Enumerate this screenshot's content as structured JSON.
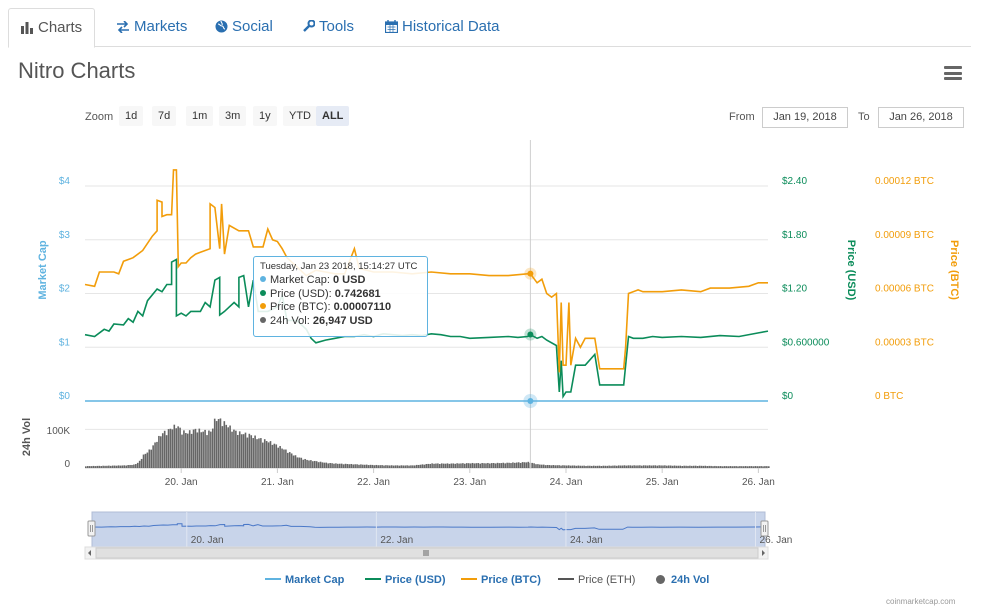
{
  "tabs": [
    {
      "label": "Charts",
      "icon": "bar-chart-icon"
    },
    {
      "label": "Markets",
      "icon": "exchange-arrows-icon"
    },
    {
      "label": "Social",
      "icon": "globe-icon"
    },
    {
      "label": "Tools",
      "icon": "wrench-icon"
    },
    {
      "label": "Historical Data",
      "icon": "calendar-icon"
    }
  ],
  "page_title": "Nitro Charts",
  "menu_icon": "hamburger-menu-icon",
  "range_selector": {
    "zoom_label": "Zoom",
    "buttons": [
      "1d",
      "7d",
      "1m",
      "3m",
      "1y",
      "YTD",
      "ALL"
    ],
    "selected": "ALL",
    "from_label": "From",
    "from_value": "Jan 19, 2018",
    "to_label": "To",
    "to_value": "Jan 26, 2018"
  },
  "tooltip": {
    "header": "Tuesday, Jan 23 2018, 15:14:27 UTC",
    "rows": [
      {
        "label": "Market Cap:",
        "value": "0 USD",
        "color": "#5fb3e0"
      },
      {
        "label": "Price (USD):",
        "value": "0.742681",
        "color": "#0b8c5a"
      },
      {
        "label": "Price (BTC):",
        "value": "0.00007110",
        "color": "#f29d0a"
      },
      {
        "label": "24h Vol:",
        "value": "26,947 USD",
        "color": "#666666"
      }
    ]
  },
  "legend": [
    {
      "label": "Market Cap",
      "color": "#5fb3e0",
      "type": "line"
    },
    {
      "label": "Price (USD)",
      "color": "#0b8c5a",
      "type": "line"
    },
    {
      "label": "Price (BTC)",
      "color": "#f29d0a",
      "type": "line"
    },
    {
      "label": "Price (ETH)",
      "color": "#555555",
      "type": "line"
    },
    {
      "label": "24h Vol",
      "color": "#666666",
      "type": "dot"
    }
  ],
  "credit": "coinmarketcap.com",
  "chart_data": {
    "type": "line",
    "x_unit": "days since Jan 19 00:00",
    "x_range": [
      0.0,
      7.1
    ],
    "x_tick_labels": [
      "20. Jan",
      "21. Jan",
      "22. Jan",
      "23. Jan",
      "24. Jan",
      "25. Jan",
      "26. Jan"
    ],
    "crosshair_x": 4.63,
    "axes": {
      "market_cap": {
        "label": "Market Cap",
        "ticks": [
          "$0",
          "$1",
          "$2",
          "$3",
          "$4"
        ],
        "range": [
          0,
          4.5
        ]
      },
      "price_usd": {
        "label": "Price (USD)",
        "ticks": [
          "$0",
          "$0.600000",
          "$1.20",
          "$1.80",
          "$2.40"
        ],
        "range": [
          0,
          2.4
        ]
      },
      "price_btc": {
        "label": "Price (BTC)",
        "ticks": [
          "0 BTC",
          "0.00003 BTC",
          "0.00006 BTC",
          "0.00009 BTC",
          "0.00012 BTC"
        ],
        "range": [
          0,
          0.00012
        ]
      },
      "volume": {
        "label": "24h Vol",
        "ticks": [
          "0",
          "100K"
        ],
        "range": [
          0,
          150000
        ]
      }
    },
    "series": [
      {
        "name": "Market Cap",
        "color": "#5fb3e0",
        "points": [
          [
            0.0,
            0
          ],
          [
            7.1,
            0
          ]
        ]
      },
      {
        "name": "Price (USD)",
        "color": "#0b8c5a",
        "points": [
          [
            0.0,
            0.74
          ],
          [
            0.1,
            0.72
          ],
          [
            0.2,
            0.8
          ],
          [
            0.25,
            0.78
          ],
          [
            0.3,
            0.86
          ],
          [
            0.4,
            0.85
          ],
          [
            0.45,
            0.92
          ],
          [
            0.5,
            0.88
          ],
          [
            0.55,
            1.0
          ],
          [
            0.6,
            0.95
          ],
          [
            0.65,
            1.12
          ],
          [
            0.75,
            1.25
          ],
          [
            0.8,
            1.22
          ],
          [
            0.85,
            1.3
          ],
          [
            0.9,
            1.3
          ],
          [
            0.9,
            1.55
          ],
          [
            0.95,
            1.58
          ],
          [
            0.95,
            0.95
          ],
          [
            1.0,
            0.98
          ],
          [
            1.05,
            0.95
          ],
          [
            1.1,
            1.0
          ],
          [
            1.2,
            1.0
          ],
          [
            1.25,
            1.1
          ],
          [
            1.3,
            1.05
          ],
          [
            1.35,
            1.35
          ],
          [
            1.4,
            1.38
          ],
          [
            1.4,
            0.96
          ],
          [
            1.45,
            1.0
          ],
          [
            1.5,
            1.05
          ],
          [
            1.55,
            1.1
          ],
          [
            1.6,
            1.05
          ],
          [
            1.6,
            1.38
          ],
          [
            1.65,
            1.4
          ],
          [
            1.7,
            1.05
          ],
          [
            1.75,
            1.35
          ],
          [
            1.8,
            1.0
          ],
          [
            1.9,
            1.0
          ],
          [
            2.0,
            1.05
          ],
          [
            2.05,
            1.18
          ],
          [
            2.1,
            0.9
          ],
          [
            2.2,
            0.9
          ],
          [
            2.3,
            0.8
          ],
          [
            2.35,
            0.7
          ],
          [
            2.4,
            0.65
          ],
          [
            2.5,
            0.68
          ],
          [
            2.6,
            0.7
          ],
          [
            2.7,
            0.72
          ],
          [
            2.8,
            0.72
          ],
          [
            2.9,
            0.74
          ],
          [
            3.0,
            0.72
          ],
          [
            3.1,
            0.75
          ],
          [
            3.2,
            0.74
          ],
          [
            3.3,
            0.73
          ],
          [
            3.4,
            0.74
          ],
          [
            3.5,
            0.73
          ],
          [
            3.6,
            0.75
          ],
          [
            3.7,
            0.74
          ],
          [
            3.8,
            0.72
          ],
          [
            3.9,
            0.72
          ],
          [
            4.0,
            0.7
          ],
          [
            4.2,
            0.71
          ],
          [
            4.4,
            0.72
          ],
          [
            4.5,
            0.71
          ],
          [
            4.6,
            0.72
          ],
          [
            4.63,
            0.74
          ],
          [
            4.7,
            0.7
          ],
          [
            4.75,
            0.72
          ],
          [
            4.8,
            0.68
          ],
          [
            4.9,
            0.62
          ],
          [
            4.93,
            0.1
          ],
          [
            4.95,
            0.45
          ],
          [
            4.97,
            0.05
          ],
          [
            5.0,
            0.1
          ],
          [
            5.05,
            0.1
          ],
          [
            5.1,
            0.4
          ],
          [
            5.2,
            0.4
          ],
          [
            5.3,
            0.52
          ],
          [
            5.35,
            0.18
          ],
          [
            5.6,
            0.18
          ],
          [
            5.65,
            0.72
          ],
          [
            5.7,
            0.7
          ],
          [
            5.8,
            0.7
          ],
          [
            5.9,
            0.72
          ],
          [
            6.0,
            0.71
          ],
          [
            6.2,
            0.72
          ],
          [
            6.4,
            0.71
          ],
          [
            6.6,
            0.73
          ],
          [
            6.8,
            0.72
          ],
          [
            7.0,
            0.76
          ],
          [
            7.1,
            0.78
          ]
        ]
      },
      {
        "name": "Price (BTC)",
        "color": "#f29d0a",
        "points": [
          [
            0.0,
            6.5e-05
          ],
          [
            0.1,
            6.4e-05
          ],
          [
            0.15,
            7.2e-05
          ],
          [
            0.3,
            7.2e-05
          ],
          [
            0.35,
            7.1e-05
          ],
          [
            0.4,
            7.8e-05
          ],
          [
            0.5,
            8e-05
          ],
          [
            0.6,
            8.4e-05
          ],
          [
            0.7,
            9.2e-05
          ],
          [
            0.75,
            9.5e-05
          ],
          [
            0.75,
            0.000112
          ],
          [
            0.8,
            0.000111
          ],
          [
            0.8,
            0.000103
          ],
          [
            0.85,
            0.000104
          ],
          [
            0.9,
            0.000104
          ],
          [
            0.92,
            0.000129
          ],
          [
            0.95,
            0.000129
          ],
          [
            0.97,
            7.5e-05
          ],
          [
            1.0,
            7.7e-05
          ],
          [
            1.05,
            7.7e-05
          ],
          [
            1.1,
            8e-05
          ],
          [
            1.15,
            8.2e-05
          ],
          [
            1.2,
            8.3e-05
          ],
          [
            1.3,
            8.5e-05
          ],
          [
            1.3,
            0.00011
          ],
          [
            1.35,
            0.000108
          ],
          [
            1.4,
            8.5e-05
          ],
          [
            1.42,
            0.00011
          ],
          [
            1.45,
            8.2e-05
          ],
          [
            1.5,
            9.8e-05
          ],
          [
            1.6,
            9.5e-05
          ],
          [
            1.7,
            9.5e-05
          ],
          [
            1.75,
            8.6e-05
          ],
          [
            1.85,
            8.6e-05
          ],
          [
            1.9,
            9.6e-05
          ],
          [
            1.95,
            9e-05
          ],
          [
            2.0,
            8.9e-05
          ],
          [
            2.05,
            8.5e-05
          ],
          [
            2.1,
            8e-05
          ],
          [
            2.2,
            7.5e-05
          ],
          [
            2.3,
            7e-05
          ],
          [
            2.4,
            7.3e-05
          ],
          [
            2.5,
            7.2e-05
          ],
          [
            2.6,
            7.1e-05
          ],
          [
            2.7,
            7.1e-05
          ],
          [
            2.8,
            8.5e-05
          ],
          [
            2.85,
            7.4e-05
          ],
          [
            3.0,
            7.2e-05
          ],
          [
            3.2,
            7.2e-05
          ],
          [
            3.4,
            7.1e-05
          ],
          [
            3.6,
            7.2e-05
          ],
          [
            3.8,
            7.1e-05
          ],
          [
            4.0,
            7.1e-05
          ],
          [
            4.2,
            7e-05
          ],
          [
            4.4,
            7e-05
          ],
          [
            4.6,
            7.1e-05
          ],
          [
            4.63,
            7.1e-05
          ],
          [
            4.7,
            6.6e-05
          ],
          [
            4.75,
            6.8e-05
          ],
          [
            4.8,
            6e-05
          ],
          [
            4.85,
            5.8e-05
          ],
          [
            4.9,
            6e-05
          ],
          [
            4.93,
            1.6e-05
          ],
          [
            4.95,
            5.5e-05
          ],
          [
            4.97,
            2e-05
          ],
          [
            5.0,
            2e-05
          ],
          [
            5.03,
            5.5e-05
          ],
          [
            5.05,
            2e-05
          ],
          [
            5.1,
            3.5e-05
          ],
          [
            5.15,
            3e-05
          ],
          [
            5.2,
            3.5e-05
          ],
          [
            5.3,
            3.5e-05
          ],
          [
            5.35,
            1.8e-05
          ],
          [
            5.6,
            1.8e-05
          ],
          [
            5.62,
            3e-05
          ],
          [
            5.65,
            6e-05
          ],
          [
            5.75,
            6.2e-05
          ],
          [
            5.8,
            6.1e-05
          ],
          [
            6.0,
            6.1e-05
          ],
          [
            6.2,
            6.2e-05
          ],
          [
            6.4,
            6.1e-05
          ],
          [
            6.5,
            6.3e-05
          ],
          [
            6.7,
            6.3e-05
          ],
          [
            6.9,
            6.4e-05
          ],
          [
            7.0,
            6.6e-05
          ],
          [
            7.1,
            6.6e-05
          ]
        ]
      }
    ],
    "volume_series": {
      "name": "24h Vol",
      "color": "#666666",
      "points": [
        [
          0.0,
          5000
        ],
        [
          0.2,
          6000
        ],
        [
          0.4,
          7000
        ],
        [
          0.5,
          9000
        ],
        [
          0.55,
          15000
        ],
        [
          0.6,
          35000
        ],
        [
          0.65,
          45000
        ],
        [
          0.7,
          60000
        ],
        [
          0.75,
          80000
        ],
        [
          0.8,
          95000
        ],
        [
          0.85,
          100000
        ],
        [
          0.9,
          110000
        ],
        [
          0.95,
          115000
        ],
        [
          1.0,
          100000
        ],
        [
          1.05,
          95000
        ],
        [
          1.1,
          100000
        ],
        [
          1.15,
          105000
        ],
        [
          1.2,
          100000
        ],
        [
          1.3,
          98000
        ],
        [
          1.35,
          135000
        ],
        [
          1.4,
          130000
        ],
        [
          1.45,
          120000
        ],
        [
          1.5,
          110000
        ],
        [
          1.55,
          100000
        ],
        [
          1.6,
          95000
        ],
        [
          1.7,
          90000
        ],
        [
          1.8,
          80000
        ],
        [
          1.9,
          72000
        ],
        [
          2.0,
          60000
        ],
        [
          2.1,
          45000
        ],
        [
          2.2,
          30000
        ],
        [
          2.3,
          22000
        ],
        [
          2.4,
          18000
        ],
        [
          2.5,
          14000
        ],
        [
          2.6,
          12000
        ],
        [
          2.8,
          10000
        ],
        [
          3.0,
          8000
        ],
        [
          3.2,
          7000
        ],
        [
          3.4,
          7000
        ],
        [
          3.6,
          12000
        ],
        [
          3.8,
          12000
        ],
        [
          4.0,
          13000
        ],
        [
          4.2,
          13000
        ],
        [
          4.4,
          14000
        ],
        [
          4.5,
          15000
        ],
        [
          4.6,
          16000
        ],
        [
          4.7,
          10000
        ],
        [
          4.8,
          8000
        ],
        [
          5.0,
          7000
        ],
        [
          5.2,
          6000
        ],
        [
          5.4,
          6000
        ],
        [
          5.6,
          7000
        ],
        [
          5.8,
          7000
        ],
        [
          6.0,
          7000
        ],
        [
          6.2,
          6000
        ],
        [
          6.4,
          6000
        ],
        [
          6.6,
          5000
        ],
        [
          6.8,
          5000
        ],
        [
          7.0,
          5000
        ],
        [
          7.1,
          5000
        ]
      ]
    },
    "navigator": {
      "x_tick_labels": [
        "20. Jan",
        "22. Jan",
        "24. Jan",
        "26. Jan"
      ],
      "selected_range": "all"
    },
    "grid": true,
    "legend_position": "bottom"
  }
}
